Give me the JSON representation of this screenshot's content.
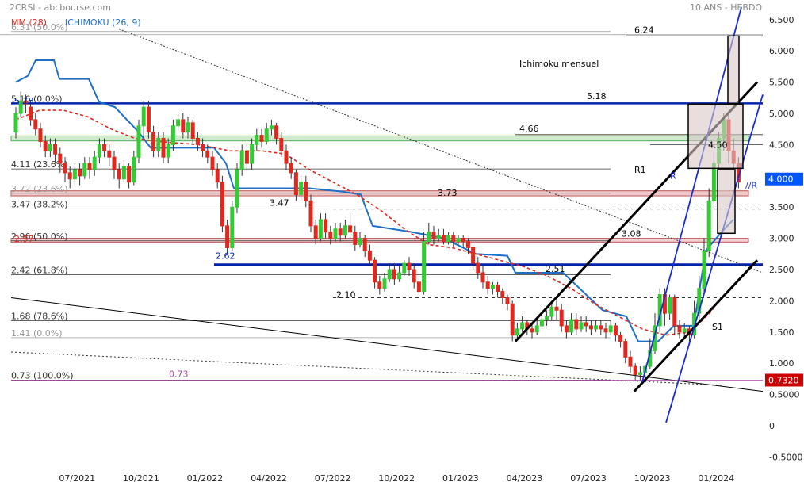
{
  "header": {
    "source": "2CRSI - abcbourse.com",
    "period": "10 ANS - HEBDO",
    "ma_label": "MM (28)",
    "ichimoku_label": "ICHIMOKU (26, 9)"
  },
  "colors": {
    "up": "#33cc33",
    "down": "#e0281e",
    "ma": "#e0281e",
    "ichimoku": "#1e6fc8",
    "fib": "#333333",
    "support": "#0022aa",
    "channel_black": "#000000",
    "channel_blue": "#1a2bd6",
    "zone_red": "#e8b4b4",
    "zone_green": "#9fd99f",
    "box_fill": "#d9c8c8",
    "last_price": "#cc0000",
    "highlight": "#0055ff"
  },
  "chart_data": {
    "type": "candlestick",
    "title": "",
    "ylim": [
      -0.5,
      6.5
    ],
    "yticks": [
      "6.500",
      "6.000",
      "5.500",
      "5.000",
      "4.500",
      "4.000",
      "3.500",
      "3.000",
      "2.500",
      "2.000",
      "1.500",
      "1.000",
      "0.5000",
      "0",
      "-0.5000"
    ],
    "ytick_values": [
      6.5,
      6.0,
      5.5,
      5.0,
      4.5,
      4.0,
      3.5,
      3.0,
      2.5,
      2.0,
      1.5,
      1.0,
      0.5,
      0,
      -0.5
    ],
    "xticks": [
      "07/2021",
      "10/2021",
      "01/2022",
      "04/2022",
      "07/2022",
      "10/2022",
      "01/2023",
      "04/2023",
      "07/2023",
      "10/2023",
      "01/2024"
    ],
    "xtick_weeks": [
      12,
      25,
      38,
      51,
      64,
      77,
      90,
      103,
      116,
      129,
      142
    ],
    "candles": [
      [
        4.7,
        5.0,
        4.6,
        5.1
      ],
      [
        5.0,
        5.2,
        4.95,
        5.35
      ],
      [
        5.2,
        5.15,
        5.0,
        5.3
      ],
      [
        5.1,
        4.9,
        4.8,
        5.2
      ],
      [
        4.9,
        4.75,
        4.65,
        5.0
      ],
      [
        4.75,
        4.55,
        4.45,
        4.85
      ],
      [
        4.55,
        4.4,
        4.3,
        4.65
      ],
      [
        4.4,
        4.5,
        4.3,
        4.6
      ],
      [
        4.5,
        4.35,
        4.2,
        4.6
      ],
      [
        4.35,
        4.2,
        4.05,
        4.45
      ],
      [
        4.2,
        4.05,
        3.9,
        4.3
      ],
      [
        4.05,
        3.95,
        3.8,
        4.15
      ],
      [
        3.95,
        4.1,
        3.85,
        4.2
      ],
      [
        4.1,
        4.0,
        3.85,
        4.2
      ],
      [
        4.0,
        4.2,
        3.95,
        4.3
      ],
      [
        4.2,
        4.1,
        3.95,
        4.3
      ],
      [
        4.1,
        4.3,
        4.0,
        4.4
      ],
      [
        4.3,
        4.5,
        4.2,
        4.6
      ],
      [
        4.5,
        4.4,
        4.3,
        4.6
      ],
      [
        4.4,
        4.3,
        4.15,
        4.5
      ],
      [
        4.3,
        4.1,
        3.95,
        4.4
      ],
      [
        4.1,
        3.95,
        3.8,
        4.2
      ],
      [
        3.95,
        4.15,
        3.9,
        4.25
      ],
      [
        4.15,
        3.9,
        3.8,
        4.2
      ],
      [
        3.9,
        4.3,
        3.85,
        4.4
      ],
      [
        4.3,
        4.8,
        4.2,
        4.9
      ],
      [
        4.8,
        5.1,
        4.6,
        5.2
      ],
      [
        5.1,
        4.7,
        4.6,
        5.2
      ],
      [
        4.7,
        4.4,
        4.3,
        4.8
      ],
      [
        4.4,
        4.6,
        4.3,
        4.7
      ],
      [
        4.6,
        4.3,
        4.2,
        4.7
      ],
      [
        4.3,
        4.5,
        4.2,
        4.6
      ],
      [
        4.5,
        4.8,
        4.4,
        4.9
      ],
      [
        4.8,
        4.9,
        4.7,
        5.0
      ],
      [
        4.9,
        4.7,
        4.6,
        5.0
      ],
      [
        4.7,
        4.85,
        4.6,
        4.95
      ],
      [
        4.85,
        4.6,
        4.5,
        4.9
      ],
      [
        4.6,
        4.5,
        4.4,
        4.7
      ],
      [
        4.5,
        4.4,
        4.3,
        4.6
      ],
      [
        4.4,
        4.3,
        4.2,
        4.5
      ],
      [
        4.3,
        4.1,
        4.0,
        4.4
      ],
      [
        4.1,
        3.9,
        3.8,
        4.2
      ],
      [
        3.9,
        3.2,
        3.1,
        4.0
      ],
      [
        3.2,
        2.85,
        2.75,
        3.3
      ],
      [
        2.85,
        3.5,
        2.8,
        3.6
      ],
      [
        3.5,
        4.1,
        3.4,
        4.2
      ],
      [
        4.1,
        4.4,
        4.0,
        4.5
      ],
      [
        4.4,
        4.2,
        4.1,
        4.5
      ],
      [
        4.2,
        4.5,
        4.1,
        4.6
      ],
      [
        4.5,
        4.65,
        4.4,
        4.75
      ],
      [
        4.65,
        4.55,
        4.45,
        4.75
      ],
      [
        4.55,
        4.75,
        4.5,
        4.85
      ],
      [
        4.75,
        4.8,
        4.65,
        4.9
      ],
      [
        4.8,
        4.6,
        4.5,
        4.85
      ],
      [
        4.6,
        4.4,
        4.3,
        4.7
      ],
      [
        4.4,
        4.2,
        4.1,
        4.5
      ],
      [
        4.2,
        4.05,
        3.95,
        4.3
      ],
      [
        4.05,
        3.7,
        3.6,
        4.1
      ],
      [
        3.7,
        3.9,
        3.6,
        4.0
      ],
      [
        3.9,
        3.6,
        3.5,
        4.0
      ],
      [
        3.6,
        3.2,
        3.1,
        3.7
      ],
      [
        3.2,
        3.0,
        2.9,
        3.3
      ],
      [
        3.0,
        3.3,
        2.95,
        3.4
      ],
      [
        3.3,
        3.1,
        3.0,
        3.4
      ],
      [
        3.1,
        3.0,
        2.9,
        3.2
      ],
      [
        3.0,
        3.15,
        2.95,
        3.25
      ],
      [
        3.15,
        3.05,
        2.95,
        3.25
      ],
      [
        3.05,
        3.2,
        3.0,
        3.3
      ],
      [
        3.2,
        3.1,
        3.0,
        3.4
      ],
      [
        3.1,
        2.9,
        2.8,
        3.2
      ],
      [
        2.9,
        3.0,
        2.85,
        3.1
      ],
      [
        3.0,
        2.8,
        2.7,
        3.05
      ],
      [
        2.8,
        2.65,
        2.55,
        2.9
      ],
      [
        2.65,
        2.3,
        2.2,
        2.7
      ],
      [
        2.3,
        2.2,
        2.1,
        2.4
      ],
      [
        2.2,
        2.35,
        2.15,
        2.45
      ],
      [
        2.35,
        2.5,
        2.3,
        2.6
      ],
      [
        2.5,
        2.35,
        2.25,
        2.6
      ],
      [
        2.35,
        2.45,
        2.3,
        2.55
      ],
      [
        2.45,
        2.6,
        2.4,
        2.65
      ],
      [
        2.6,
        2.5,
        2.4,
        2.7
      ],
      [
        2.5,
        2.3,
        2.2,
        2.6
      ],
      [
        2.3,
        2.15,
        2.1,
        2.4
      ],
      [
        2.15,
        2.95,
        2.1,
        3.1
      ],
      [
        2.95,
        3.1,
        2.9,
        3.25
      ],
      [
        3.1,
        3.0,
        2.9,
        3.2
      ],
      [
        3.0,
        3.05,
        2.95,
        3.15
      ],
      [
        3.05,
        2.95,
        2.9,
        3.15
      ],
      [
        2.95,
        3.05,
        2.9,
        3.1
      ],
      [
        3.05,
        2.95,
        2.85,
        3.1
      ],
      [
        2.95,
        3.0,
        2.9,
        3.05
      ],
      [
        3.0,
        2.95,
        2.85,
        3.05
      ],
      [
        2.95,
        2.85,
        2.75,
        3.0
      ],
      [
        2.85,
        2.6,
        2.5,
        2.9
      ],
      [
        2.6,
        2.45,
        2.35,
        2.7
      ],
      [
        2.45,
        2.3,
        2.2,
        2.55
      ],
      [
        2.3,
        2.2,
        2.1,
        2.4
      ],
      [
        2.2,
        2.25,
        2.1,
        2.3
      ],
      [
        2.25,
        2.15,
        2.05,
        2.3
      ],
      [
        2.15,
        2.05,
        1.95,
        2.2
      ],
      [
        2.05,
        1.95,
        1.85,
        2.1
      ],
      [
        1.95,
        1.45,
        1.35,
        2.0
      ],
      [
        1.45,
        1.55,
        1.4,
        1.65
      ],
      [
        1.55,
        1.65,
        1.5,
        1.75
      ],
      [
        1.65,
        1.55,
        1.45,
        1.7
      ],
      [
        1.55,
        1.5,
        1.4,
        1.65
      ],
      [
        1.5,
        1.6,
        1.45,
        1.7
      ],
      [
        1.6,
        1.7,
        1.55,
        1.8
      ],
      [
        1.7,
        1.75,
        1.6,
        1.85
      ],
      [
        1.75,
        1.9,
        1.7,
        2.0
      ],
      [
        1.9,
        1.85,
        1.7,
        2.0
      ],
      [
        1.85,
        1.6,
        1.5,
        1.95
      ],
      [
        1.6,
        1.5,
        1.4,
        1.7
      ],
      [
        1.5,
        1.7,
        1.45,
        1.8
      ],
      [
        1.7,
        1.55,
        1.45,
        1.8
      ],
      [
        1.55,
        1.65,
        1.5,
        1.75
      ],
      [
        1.65,
        1.6,
        1.5,
        1.75
      ],
      [
        1.6,
        1.55,
        1.45,
        1.7
      ],
      [
        1.55,
        1.6,
        1.5,
        1.7
      ],
      [
        1.6,
        1.55,
        1.45,
        1.7
      ],
      [
        1.55,
        1.5,
        1.4,
        1.65
      ],
      [
        1.5,
        1.6,
        1.45,
        1.7
      ],
      [
        1.6,
        1.45,
        1.35,
        1.65
      ],
      [
        1.45,
        1.35,
        1.25,
        1.5
      ],
      [
        1.35,
        1.1,
        1.0,
        1.4
      ],
      [
        1.1,
        0.95,
        0.85,
        1.2
      ],
      [
        0.95,
        0.82,
        0.73,
        1.0
      ],
      [
        0.82,
        0.85,
        0.73,
        0.95
      ],
      [
        0.85,
        0.95,
        0.8,
        1.0
      ],
      [
        0.95,
        1.2,
        0.9,
        1.4
      ],
      [
        1.2,
        1.6,
        1.15,
        1.8
      ],
      [
        1.6,
        2.1,
        1.5,
        2.2
      ],
      [
        2.1,
        1.8,
        1.6,
        2.2
      ],
      [
        1.8,
        2.05,
        1.7,
        2.1
      ],
      [
        2.05,
        1.6,
        1.45,
        2.1
      ],
      [
        1.6,
        1.5,
        1.4,
        1.7
      ],
      [
        1.5,
        1.55,
        1.4,
        1.65
      ],
      [
        1.55,
        1.45,
        1.35,
        1.6
      ],
      [
        1.45,
        1.8,
        1.4,
        2.0
      ],
      [
        1.8,
        2.2,
        1.7,
        2.4
      ],
      [
        2.2,
        2.8,
        2.1,
        3.0
      ],
      [
        2.8,
        3.6,
        2.7,
        3.8
      ],
      [
        3.6,
        4.2,
        3.5,
        4.4
      ],
      [
        4.2,
        4.6,
        4.1,
        4.7
      ],
      [
        4.6,
        4.9,
        4.4,
        5.0
      ],
      [
        4.9,
        4.4,
        4.2,
        5.0
      ],
      [
        4.4,
        4.2,
        4.1,
        4.6
      ],
      [
        4.2,
        3.9,
        3.8,
        4.3
      ]
    ],
    "fib_levels": [
      {
        "label": "6.31  (50.0%)",
        "y": 6.31,
        "color": "#999999"
      },
      {
        "label": "5.16  (0.0%)",
        "y": 5.16,
        "color": "#333333"
      },
      {
        "label": "4.11  (23.6%)",
        "y": 4.11,
        "color": "#333333"
      },
      {
        "label": "3.72  (23.6%)",
        "y": 3.72,
        "color": "#999999"
      },
      {
        "label": "3.47  (38.2%)",
        "y": 3.47,
        "color": "#333333"
      },
      {
        "label": "2.96  (50.0%)",
        "y": 2.96,
        "color": "#333333"
      },
      {
        "label": "2.42  (61.8%)",
        "y": 2.42,
        "color": "#333333"
      },
      {
        "label": "1.68  (78.6%)",
        "y": 1.68,
        "color": "#333333"
      },
      {
        "label": "1.41  (0.0%)",
        "y": 1.41,
        "color": "#999999"
      },
      {
        "label": "0.73  (100.0%)",
        "y": 0.73,
        "color": "#333333"
      }
    ],
    "annotations": [
      {
        "text": "6.24",
        "y": 6.24
      },
      {
        "text": "5.18",
        "y": 5.18
      },
      {
        "text": "4.66",
        "y": 4.66
      },
      {
        "text": "4.50",
        "y": 4.5
      },
      {
        "text": "3.73",
        "y": 3.73
      },
      {
        "text": "3.47",
        "y": 3.47
      },
      {
        "text": "3.08",
        "y": 3.08
      },
      {
        "text": "2.97",
        "y": 2.97
      },
      {
        "text": "2.62",
        "y": 2.62
      },
      {
        "text": "2.51",
        "y": 2.51
      },
      {
        "text": "2.10",
        "y": 2.1
      },
      {
        "text": "0.73",
        "y": 0.73
      },
      {
        "text": "5.18",
        "y": 5.18
      },
      {
        "text": "Ichimoku mensuel",
        "y": 5.75
      },
      {
        "text": "R1",
        "y": 4.1
      },
      {
        "text": "R",
        "y": 3.95
      },
      {
        "text": "//R",
        "y": 3.8
      },
      {
        "text": "S1",
        "y": 1.6
      }
    ],
    "last_price": "0.7320",
    "highlight_price": "4.000",
    "legend_placement": "top-left"
  }
}
